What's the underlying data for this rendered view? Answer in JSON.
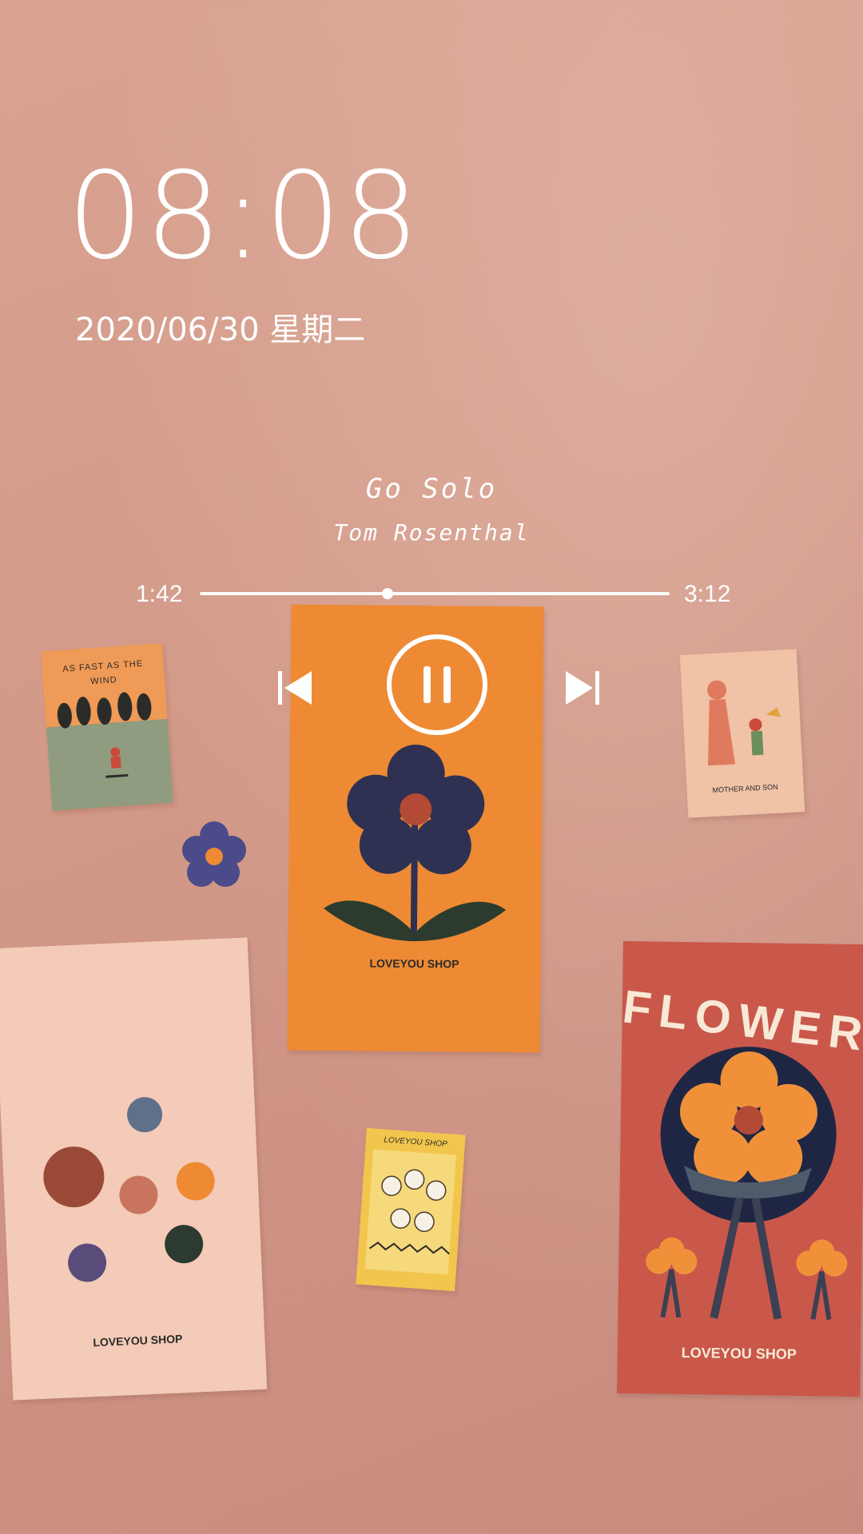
{
  "lockscreen": {
    "time": "08:08",
    "date": "2020/06/30 星期二"
  },
  "player": {
    "title": "Go Solo",
    "artist": "Tom Rosenthal",
    "elapsed": "1:42",
    "total": "3:12",
    "progress_fraction": 0.4,
    "controls": {
      "previous": "skip-previous-icon",
      "play_pause": "pause-icon",
      "next": "skip-next-icon"
    }
  },
  "wallpaper": {
    "card_orange_flower_label": "LOVEYOU SHOP",
    "card_faces_label": "LOVEYOU SHOP",
    "card_flower_poster_title": "FLOWER",
    "card_flower_poster_label": "LOVEYOU SHOP",
    "card_peanuts_label": "LOVEYOU SHOP",
    "card_wind_text_line1": "AS FAST AS THE",
    "card_wind_text_line2": "WIND",
    "card_mother_son_text": "MOTHER AND SON"
  },
  "colors": {
    "wall": "#d39a89",
    "orange_card": "#ee8a34",
    "navy": "#2e3152",
    "red_poster": "#c9584a"
  }
}
